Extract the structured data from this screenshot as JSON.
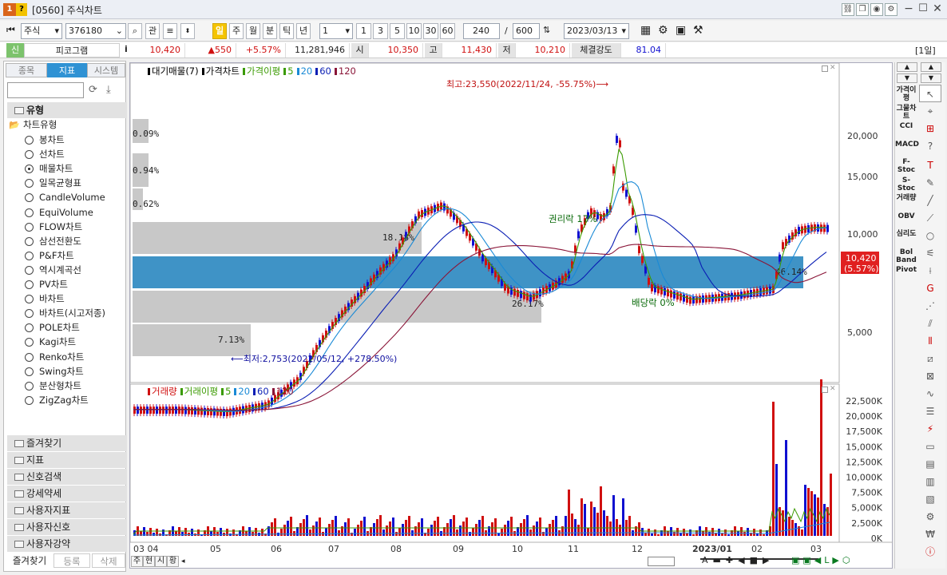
{
  "window": {
    "title": "[0560] 주식차트",
    "logo": "1",
    "logo2": "?"
  },
  "toolbar": {
    "market": "주식",
    "code": "376180",
    "btn_gwan": "관",
    "periods": [
      "일",
      "주",
      "월",
      "분",
      "틱",
      "년"
    ],
    "interval": "1",
    "minutes": [
      "1",
      "3",
      "5",
      "10",
      "30",
      "60"
    ],
    "count": "240",
    "slash": "/",
    "total": "600",
    "date": "2023/03/13"
  },
  "info": {
    "flag": "신",
    "name": "피코그램",
    "i": "i",
    "price": "10,420",
    "change": "▲550",
    "pct": "+5.57%",
    "volume": "11,281,946",
    "open_label": "시",
    "open": "10,350",
    "high_label": "고",
    "high": "11,430",
    "low_label": "저",
    "low": "10,210",
    "strength_label": "체결강도",
    "strength": "81.04",
    "period_badge": "[1일]"
  },
  "left": {
    "tabs": [
      "종목",
      "지표",
      "시스템"
    ],
    "sec_type": "유형",
    "chart_type_group": "차트유형",
    "chart_types": [
      "봉차트",
      "선차트",
      "매물차트",
      "일목균형표",
      "CandleVolume",
      "EquiVolume",
      "FLOW차트",
      "삼선전환도",
      "P&F차트",
      "역시계곡선",
      "PV차트",
      "바차트",
      "바차트(시고저종)",
      "POLE차트",
      "Kagi차트",
      "Renko차트",
      "Swing차트",
      "분산형차트",
      "ZigZag차트"
    ],
    "selected_index": 2,
    "sections": [
      "즐겨찾기",
      "지표",
      "신호검색",
      "강세약세",
      "사용자지표",
      "사용자신호",
      "사용자강약"
    ],
    "bottom_tabs": [
      "즐겨찾기",
      "등록",
      "삭제"
    ]
  },
  "chart": {
    "price_legend": [
      {
        "text": "대기매물(7)",
        "color": "#000000"
      },
      {
        "text": "가격차트",
        "color": "#000000"
      },
      {
        "text": "가격이평",
        "color": "#3a9a00"
      },
      {
        "text": "5",
        "color": "#3a9a00"
      },
      {
        "text": "20",
        "color": "#1a8ad6"
      },
      {
        "text": "60",
        "color": "#0a1eb4"
      },
      {
        "text": "120",
        "color": "#8a1538"
      }
    ],
    "volume_legend": [
      {
        "text": "거래량",
        "color": "#d01010"
      },
      {
        "text": "거래이평",
        "color": "#3a9a00"
      },
      {
        "text": "5",
        "color": "#3a9a00"
      },
      {
        "text": "20",
        "color": "#1a8ad6"
      },
      {
        "text": "60",
        "color": "#0a1eb4"
      },
      {
        "text": "120",
        "color": "#8a1538"
      }
    ],
    "y_labels": [
      "20,000",
      "15,000",
      "10,000",
      "5,000"
    ],
    "vol_labels": [
      "22,500K",
      "20,000K",
      "17,500K",
      "15,000K",
      "12,500K",
      "10,000K",
      "7,500K",
      "5,000K",
      "2,500K",
      "0K"
    ],
    "x_labels": [
      "03 04",
      "05",
      "06",
      "07",
      "08",
      "09",
      "10",
      "11",
      "12",
      "2023/01",
      "02",
      "03"
    ],
    "profile_pcts": [
      "0.09%",
      "0.94%",
      "0.62%",
      "18.18%",
      "46.14%",
      "26.17%",
      "7.13%"
    ],
    "high_note": "최고:23,550(2022/11/24, -55.75%)⟶",
    "low_note": "⟵최저:2,753(2022/05/12, +278.50%)",
    "rights_note": "권리락 17%",
    "div_note": "배당락 0%",
    "price_tag": "10,420",
    "pct_tag": "(5.57%)",
    "bottom_tabs": [
      "주",
      "현",
      "시",
      "황"
    ],
    "colors": {
      "up": "#d01010",
      "down": "#1010d0",
      "profile": "#c8c8c8",
      "profile_hot": "#3f93c6"
    }
  },
  "right": {
    "indicators": [
      "가격이평",
      "그물차트",
      "CCI",
      "MACD",
      "F-Stoc",
      "S-Stoc",
      "거래량",
      "OBV",
      "심리도",
      "Bol Band",
      "Pivot"
    ]
  }
}
